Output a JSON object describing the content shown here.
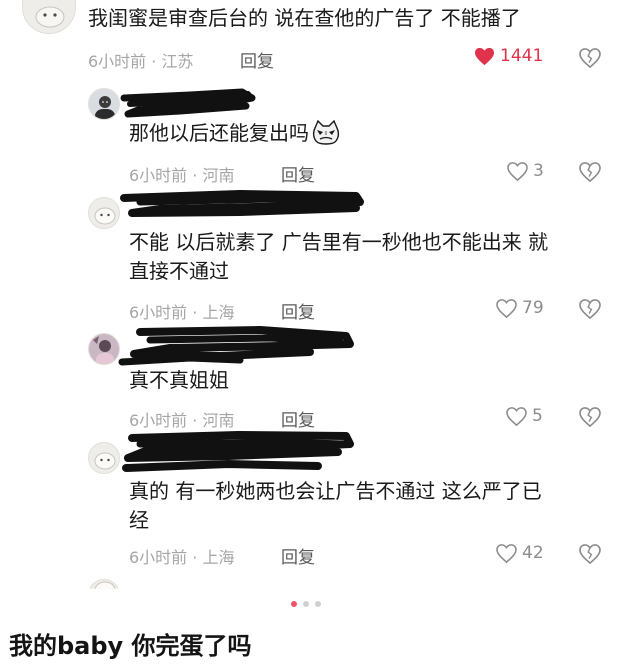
{
  "comments": [
    {
      "text_lines": [
        "我闺蜜是审查后台的 说在查他的广告了 不能播了"
      ],
      "meta": "6小时前 · 江苏",
      "reply_label": "回复",
      "likes": "1441",
      "liked": true
    },
    {
      "text_lines": [
        "那他以后还能复出吗"
      ],
      "meta": "6小时前 · 河南",
      "reply_label": "回复",
      "likes": "3",
      "liked": false
    },
    {
      "text_lines": [
        "不能 以后就素了 广告里有一秒他也不能出来 就",
        "直接不通过"
      ],
      "meta": "6小时前 · 上海",
      "reply_label": "回复",
      "likes": "79",
      "liked": false
    },
    {
      "text_lines": [
        "真不真姐姐"
      ],
      "meta": "6小时前 · 河南",
      "reply_label": "回复",
      "likes": "5",
      "liked": false
    },
    {
      "text_lines": [
        "真的 有一秒她两也会让广告不通过 这么严了已",
        "经"
      ],
      "meta": "6小时前 · 上海",
      "reply_label": "回复",
      "likes": "42",
      "liked": false
    }
  ],
  "pagination": {
    "total": 3,
    "active": 0
  },
  "caption": "我的baby 你完蛋了吗",
  "colors": {
    "liked_heart": "#e0324a",
    "text": "#1a1a1a",
    "meta": "#a6a6a6",
    "scribble": "#111111",
    "dot_active": "#f0546a"
  },
  "icons": [
    "heart-icon",
    "dislike-broken-heart-icon",
    "cat-emoji-icon",
    "avatar"
  ]
}
